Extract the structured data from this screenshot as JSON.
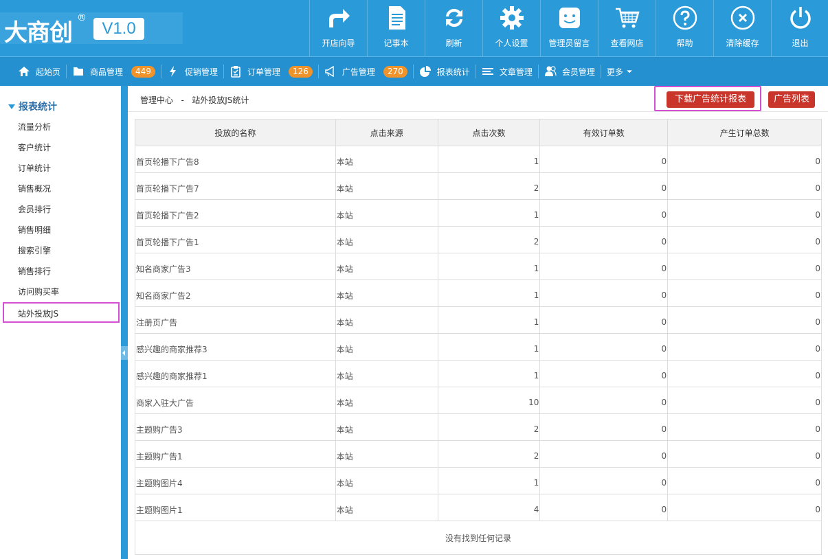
{
  "logo": {
    "text": "大商创",
    "reg": "®",
    "version": "V1.0"
  },
  "toolbar": [
    {
      "label": "开店向导",
      "icon": "share-arrow-icon"
    },
    {
      "label": "记事本",
      "icon": "notepad-icon"
    },
    {
      "label": "刷新",
      "icon": "refresh-icon"
    },
    {
      "label": "个人设置",
      "icon": "gear-icon"
    },
    {
      "label": "管理员留言",
      "icon": "message-face-icon"
    },
    {
      "label": "查看网店",
      "icon": "cart-icon"
    },
    {
      "label": "帮助",
      "icon": "help-icon"
    },
    {
      "label": "清除缓存",
      "icon": "clear-icon"
    },
    {
      "label": "退出",
      "icon": "power-icon"
    }
  ],
  "nav": [
    {
      "label": "起始页",
      "icon": "home-icon"
    },
    {
      "label": "商品管理",
      "icon": "folder-icon",
      "badge": "449"
    },
    {
      "label": "促销管理",
      "icon": "bolt-icon"
    },
    {
      "label": "订单管理",
      "icon": "clipboard-icon",
      "badge": "126"
    },
    {
      "label": "广告管理",
      "icon": "megaphone-icon",
      "badge": "270"
    },
    {
      "label": "报表统计",
      "icon": "pie-chart-icon"
    },
    {
      "label": "文章管理",
      "icon": "list-icon"
    },
    {
      "label": "会员管理",
      "icon": "users-icon"
    },
    {
      "label": "更多",
      "icon": "caret-down-icon"
    }
  ],
  "sidebar": {
    "title": "报表统计",
    "items": [
      "流量分析",
      "客户统计",
      "订单统计",
      "销售概况",
      "会员排行",
      "销售明细",
      "搜索引擎",
      "销售排行",
      "访问购买率",
      "站外投放JS"
    ],
    "active_index": 9
  },
  "breadcrumb": {
    "root": "管理中心",
    "sep": "-",
    "current": "站外投放JS统计"
  },
  "buttons": {
    "download": "下载广告统计报表",
    "list": "广告列表"
  },
  "table": {
    "headers": [
      "投放的名称",
      "点击来源",
      "点击次数",
      "有效订单数",
      "产生订单总数"
    ],
    "rows": [
      [
        "首页轮播下广告8",
        "本站",
        "1",
        "0",
        "0"
      ],
      [
        "首页轮播下广告7",
        "本站",
        "2",
        "0",
        "0"
      ],
      [
        "首页轮播下广告2",
        "本站",
        "1",
        "0",
        "0"
      ],
      [
        "首页轮播下广告1",
        "本站",
        "2",
        "0",
        "0"
      ],
      [
        "知名商家广告3",
        "本站",
        "1",
        "0",
        "0"
      ],
      [
        "知名商家广告2",
        "本站",
        "1",
        "0",
        "0"
      ],
      [
        "注册页广告",
        "本站",
        "1",
        "0",
        "0"
      ],
      [
        "感兴趣的商家推荐3",
        "本站",
        "1",
        "0",
        "0"
      ],
      [
        "感兴趣的商家推荐1",
        "本站",
        "1",
        "0",
        "0"
      ],
      [
        "商家入驻大广告",
        "本站",
        "10",
        "0",
        "0"
      ],
      [
        "主题购广告3",
        "本站",
        "2",
        "0",
        "0"
      ],
      [
        "主题购广告1",
        "本站",
        "2",
        "0",
        "0"
      ],
      [
        "主题购图片4",
        "本站",
        "1",
        "0",
        "0"
      ],
      [
        "主题购图片1",
        "本站",
        "4",
        "0",
        "0"
      ]
    ],
    "empty_text": "没有找到任何记录"
  }
}
